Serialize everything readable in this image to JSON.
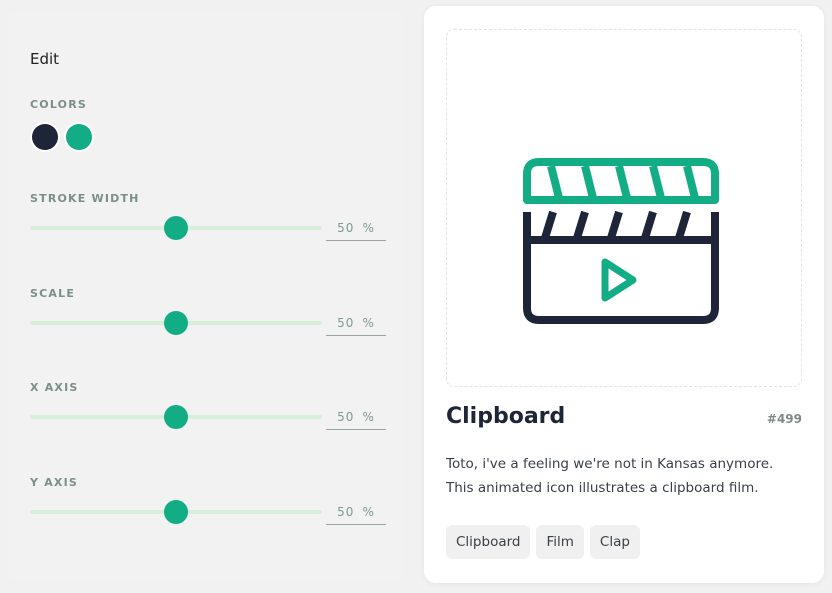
{
  "editor": {
    "title": "Edit",
    "colors_label": "COLORS",
    "colors": [
      {
        "name": "dark",
        "hex": "#1f2538"
      },
      {
        "name": "green",
        "hex": "#12ad85"
      }
    ],
    "sliders": [
      {
        "label": "STROKE WIDTH",
        "value": "50",
        "unit": "%"
      },
      {
        "label": "SCALE",
        "value": "50",
        "unit": "%"
      },
      {
        "label": "X AXIS",
        "value": "50",
        "unit": "%"
      },
      {
        "label": "Y AXIS",
        "value": "50",
        "unit": "%"
      }
    ]
  },
  "icon": {
    "name": "Clipboard",
    "id": "#499",
    "description": "Toto, i've a feeling we're not in Kansas anymore. This animated icon illustrates a clipboard film.",
    "tags": [
      "Clipboard",
      "Film",
      "Clap"
    ],
    "colors": {
      "primary": "#1f2538",
      "accent": "#12ad85"
    }
  }
}
